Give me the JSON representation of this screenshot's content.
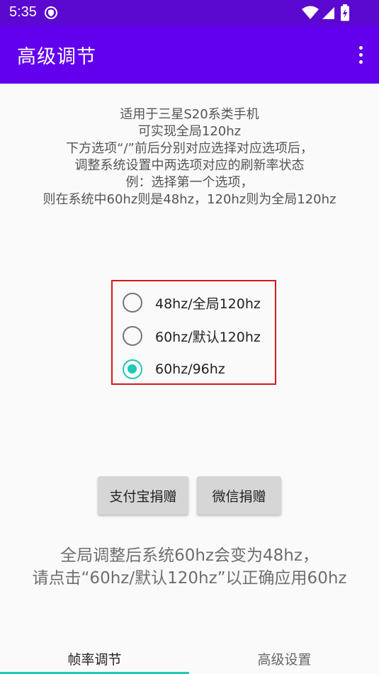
{
  "status_bar": {
    "time": "5:35",
    "icons": [
      "shield-icon",
      "wifi-icon",
      "signal-icon",
      "battery-charging-icon"
    ]
  },
  "app_bar": {
    "title": "高级调节",
    "menu_icon": "more-vert-icon",
    "color": "#6200ee"
  },
  "description": {
    "lines": [
      "适用于三星S20系类手机",
      "可实现全局120hz",
      "下方选项“/”前后分别对应选择对应选项后，",
      "调整系统设置中两选项对应的刷新率状态",
      "例：选择第一个选项，",
      "则在系统中60hz则是48hz，120hz则为全局120hz"
    ]
  },
  "refresh_options": {
    "items": [
      {
        "label": "48hz/全局120hz",
        "checked": false
      },
      {
        "label": "60hz/默认120hz",
        "checked": false
      },
      {
        "label": "60hz/96hz",
        "checked": true
      }
    ],
    "accent": "#1ec9b6",
    "border_color": "#d21a1a"
  },
  "buttons": {
    "alipay": "支付宝捐赠",
    "wechat": "微信捐赠"
  },
  "note": {
    "lines": [
      "全局调整后系统60hz会变为48hz，",
      "请点击“60hz/默认120hz”以正确应用60hz"
    ]
  },
  "tabs": {
    "items": [
      "帧率调节",
      "高级设置"
    ],
    "selected": 0
  }
}
